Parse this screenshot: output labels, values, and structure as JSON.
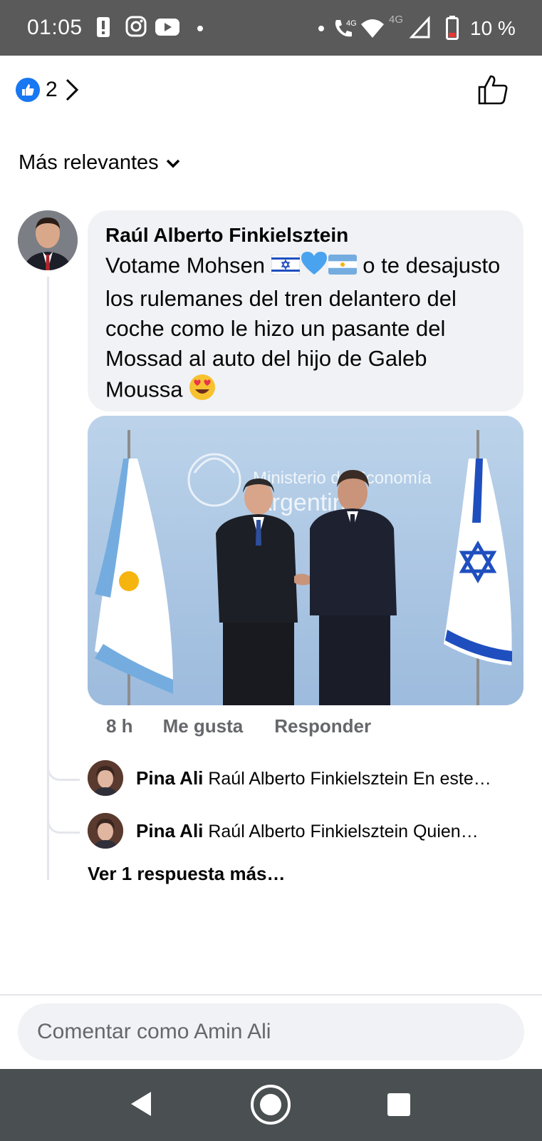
{
  "status_bar": {
    "time": "01:05",
    "battery": "10 %",
    "network_1": "4G",
    "network_2": "4G",
    "icons": [
      "alert-icon",
      "instagram-icon",
      "youtube-icon",
      "dot-icon",
      "call-icon",
      "wifi-icon",
      "signal-icon",
      "battery-icon"
    ]
  },
  "reactions": {
    "count": "2",
    "icon": "like-icon"
  },
  "sort": {
    "label": "Más relevantes"
  },
  "comment": {
    "author": "Raúl Alberto Finkielsztein",
    "text_part1": "Votame Mohsen",
    "text_part2": " o te desajusto los rulemanes del tren delantero del coche como le hizo un pasante del Mossad al auto del hijo de Galeb Moussa",
    "emoji_1": "🇮🇱",
    "emoji_2": "💙",
    "emoji_3": "🇦🇷",
    "emoji_4": "😍",
    "photo_sign_1": "Ministerio de Economía",
    "photo_sign_2": "Argentina",
    "time": "8 h",
    "like_label": "Me gusta",
    "reply_label": "Responder"
  },
  "replies": [
    {
      "name": "Pina Ali",
      "text": "Raúl Alberto Finkielsztein  En este…"
    },
    {
      "name": "Pina Ali",
      "text": "Raúl Alberto Finkielsztein   Quien…"
    }
  ],
  "more_replies": "Ver 1 respuesta más…",
  "composer": {
    "placeholder": "Comentar como Amin Ali"
  },
  "colors": {
    "accent": "#1877f2",
    "bubble": "#f0f2f5",
    "secondary_text": "#65676b",
    "status_bar": "#5a5a5a",
    "nav_bar": "#4a4f52"
  }
}
